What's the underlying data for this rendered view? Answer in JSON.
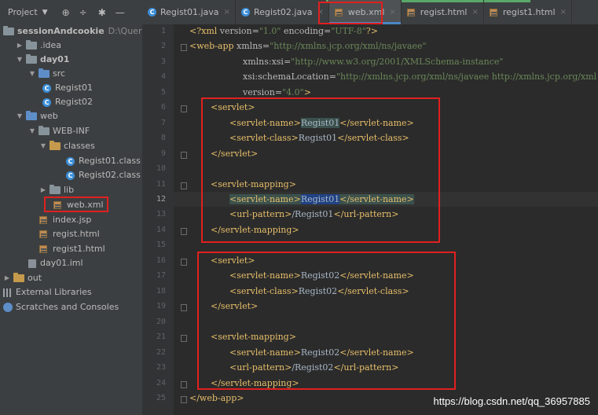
{
  "project_header": {
    "title": "Project",
    "caret": "▼",
    "icons": [
      "globe-target-icon",
      "collapse-icon",
      "gear-icon",
      "minimize-icon"
    ]
  },
  "tabs": [
    {
      "label": "Regist01.java",
      "icon": "class-icon",
      "active": false
    },
    {
      "label": "Regist02.java",
      "icon": "class-icon",
      "active": false
    },
    {
      "label": "web.xml",
      "icon": "xml-icon",
      "active": true
    },
    {
      "label": "regist.html",
      "icon": "html-icon",
      "active": false
    },
    {
      "label": "regist1.html",
      "icon": "html-icon",
      "active": false
    }
  ],
  "tree": [
    {
      "label": "sessionAndcookie",
      "extra": "D:\\QuerPro"
    },
    {
      "label": ".idea"
    },
    {
      "label": "day01"
    },
    {
      "label": "src"
    },
    {
      "label": "Regist01"
    },
    {
      "label": "Regist02"
    },
    {
      "label": "web"
    },
    {
      "label": "WEB-INF"
    },
    {
      "label": "classes"
    },
    {
      "label": "Regist01.class"
    },
    {
      "label": "Regist02.class"
    },
    {
      "label": "lib"
    },
    {
      "label": "web.xml"
    },
    {
      "label": "index.jsp"
    },
    {
      "label": "regist.html"
    },
    {
      "label": "regist1.html"
    },
    {
      "label": "day01.iml"
    },
    {
      "label": "out"
    },
    {
      "label": "External Libraries"
    },
    {
      "label": "Scratches and Consoles"
    }
  ],
  "line_numbers": [
    "1",
    "2",
    "3",
    "4",
    "5",
    "6",
    "7",
    "8",
    "9",
    "10",
    "11",
    "12",
    "13",
    "14",
    "15",
    "16",
    "17",
    "18",
    "19",
    "20",
    "21",
    "22",
    "23",
    "24",
    "25"
  ],
  "code": {
    "l1_open": "<?xml ",
    "l1_attr1": "version=",
    "l1_val1": "\"1.0\"",
    "l1_attr2": " encoding=",
    "l1_val2": "\"UTF-8\"",
    "l1_close": "?>",
    "l2_tag": "<web-app ",
    "l2_attr": "xmlns=",
    "l2_val": "\"http://xmlns.jcp.org/xml/ns/javaee\"",
    "l3_attr": "xmlns:xsi=",
    "l3_val": "\"http://www.w3.org/2001/XMLSchema-instance\"",
    "l4_attr": "xsi:schemaLocation=",
    "l4_val": "\"http://xmlns.jcp.org/xml/ns/javaee http://xmlns.jcp.org/xml",
    "l5_attr": "version=",
    "l5_val": "\"4.0\"",
    "l5_close": ">",
    "servlet_open": "<servlet>",
    "servlet_close": "</servlet>",
    "mapping_open": "<servlet-mapping>",
    "mapping_close": "</servlet-mapping>",
    "name_open": "<servlet-name>",
    "name_close": "</servlet-name>",
    "class_open": "<servlet-class>",
    "class_close": "</servlet-class>",
    "url_open": "<url-pattern>",
    "url_close": "</url-pattern>",
    "regist01": "Regist01",
    "regist02": "Regist02",
    "url01": "/Regist01",
    "url02": "/Regist02",
    "webapp_close": "</web-app>"
  },
  "watermark": "https://blog.csdn.net/qq_36957885",
  "colors": {
    "tag": "#e8bf6a",
    "attr": "#bababa",
    "value": "#6a8759",
    "highlight_box": "#e02020"
  }
}
